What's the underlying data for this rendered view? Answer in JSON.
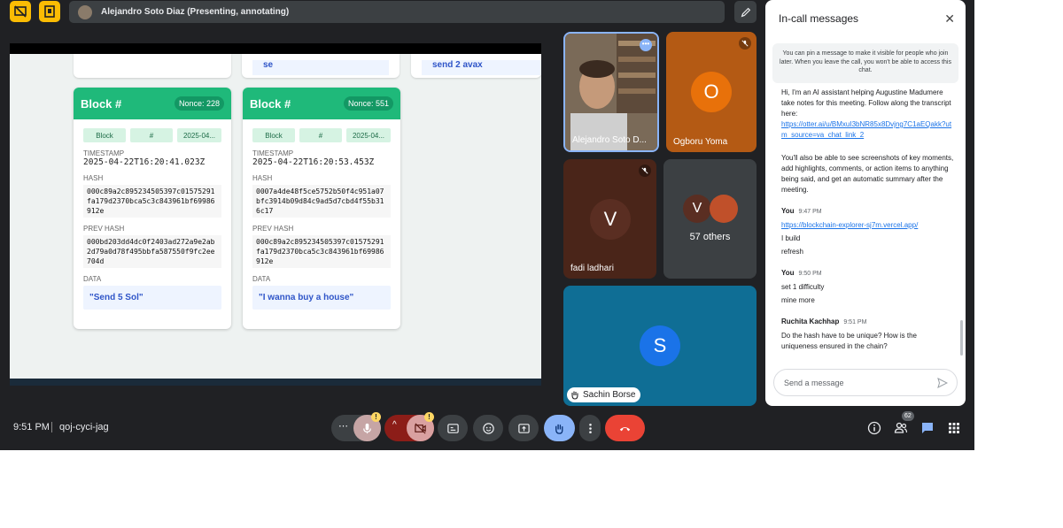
{
  "top_bar": {
    "presenting_title": "Alejandro Soto Diaz (Presenting, annotating)"
  },
  "shared_screen": {
    "prev_cards": [
      {
        "text": "se"
      },
      {
        "text": "send 2 avax"
      }
    ],
    "blocks": [
      {
        "title": "Block #",
        "nonce": "Nonce: 228",
        "chips": [
          "Block",
          "#",
          "2025-04..."
        ],
        "timestamp_label": "TIMESTAMP",
        "timestamp": "2025-04-22T16:20:41.023Z",
        "hash_label": "HASH",
        "hash": "000c89a2c895234505397c01575291fa179d2370bca5c3c843961bf69986912e",
        "prev_hash_label": "PREV HASH",
        "prev_hash": "000bd203dd4dc0f2403ad272a9e2ab2d79a0d78f495bbfa587550f9fc2ee704d",
        "data_label": "DATA",
        "data": "\"Send 5 Sol\""
      },
      {
        "title": "Block #",
        "nonce": "Nonce: 551",
        "chips": [
          "Block",
          "#",
          "2025-04..."
        ],
        "timestamp_label": "TIMESTAMP",
        "timestamp": "2025-04-22T16:20:53.453Z",
        "hash_label": "HASH",
        "hash": "0007a4de48f5ce5752b50f4c951a07bfc3914b09d84c9ad5d7cbd4f55b316c17",
        "prev_hash_label": "PREV HASH",
        "prev_hash": "000c89a2c895234505397c01575291fa179d2370bca5c3c843961bf69986912e",
        "data_label": "DATA",
        "data": "\"I wanna buy a house\""
      }
    ]
  },
  "participants": {
    "alejandro": {
      "name": "Alejandro Soto D...",
      "more": "•••"
    },
    "ogboru": {
      "name": "Ogboru Yoma",
      "initial": "O",
      "color": "#e8710a"
    },
    "fadi": {
      "name": "fadi ladhari",
      "initial": "V",
      "color": "#5a2e22"
    },
    "others": {
      "label": "57 others",
      "initial": "V"
    },
    "sachin": {
      "name": "Sachin Borse",
      "initial": "S",
      "color": "#1a73e8"
    }
  },
  "chat": {
    "title": "In-call messages",
    "notice": "You can pin a message to make it visible for people who join later. When you leave the call, you won't be able to access this chat.",
    "bot_message_1": "Hi, I'm an AI assistant helping Augustine Madumere take notes for this meeting. Follow along the transcript here:",
    "bot_link": "https://otter.ai/u/BMxuI3bNR85x8Dvjng7C1aEQakk?utm_source=va_chat_link_2",
    "bot_message_2": "You'll also be able to see screenshots of key moments, add highlights, comments, or action items to anything being said, and get an automatic summary after the meeting.",
    "messages": [
      {
        "sender": "You",
        "time": "9:47 PM",
        "link": "https://blockchain-explorer-sj7m.vercel.app/",
        "lines": [
          "I build",
          "refresh"
        ]
      },
      {
        "sender": "You",
        "time": "9:50 PM",
        "link": "",
        "lines": [
          "set 1 difficulty",
          "mine more"
        ]
      },
      {
        "sender": "Ruchita Kachhap",
        "time": "9:51 PM",
        "link": "",
        "lines": [
          "Do the hash have to be unique? How is the uniqueness ensured in the chain?"
        ]
      }
    ],
    "input_placeholder": "Send a message"
  },
  "bottom": {
    "time": "9:51 PM",
    "meeting_code": "qoj-cyci-jag",
    "people_count": "62"
  },
  "colors": {
    "background": "#202124",
    "accent_yellow": "#fbbc04",
    "end_call": "#ea4335",
    "raise_hand": "#8ab4f8",
    "block_green": "#1fb97a"
  }
}
